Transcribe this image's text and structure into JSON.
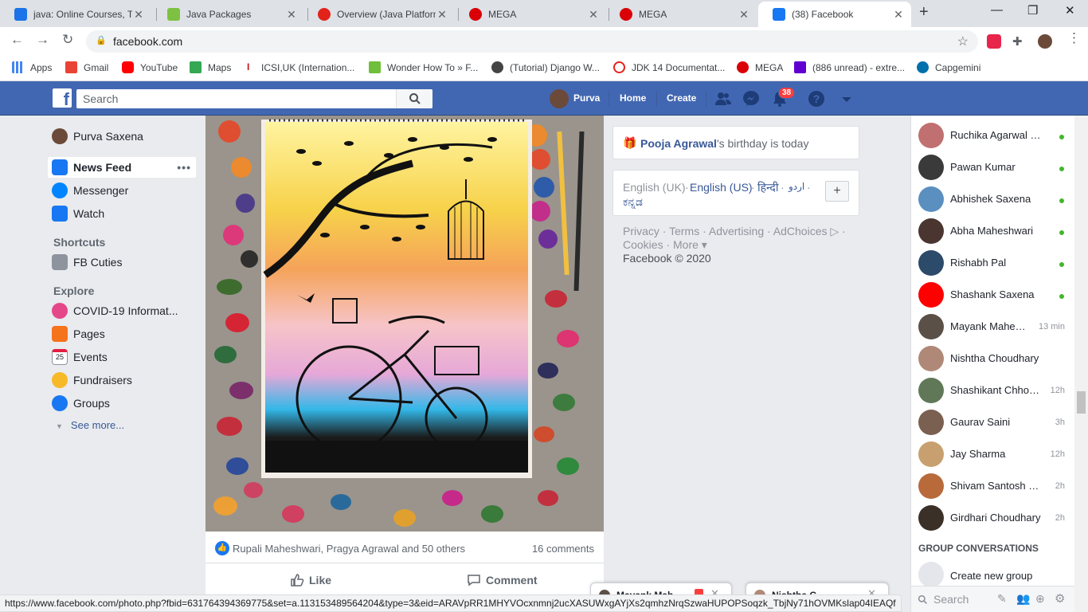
{
  "browser": {
    "tabs": [
      {
        "title": "java: Online Courses, Tr",
        "color": "#1a73e8"
      },
      {
        "title": "Java Packages",
        "color": "#7dc142"
      },
      {
        "title": "Overview (Java Platform",
        "color": "#e2231a"
      },
      {
        "title": "MEGA",
        "color": "#d90007"
      },
      {
        "title": "MEGA",
        "color": "#d90007"
      },
      {
        "title": "(38) Facebook",
        "color": "#1877f2"
      }
    ],
    "url": "facebook.com",
    "bookmarks": [
      {
        "label": "Apps",
        "color": "#4285f4"
      },
      {
        "label": "Gmail",
        "color": "#ea4335"
      },
      {
        "label": "YouTube",
        "color": "#ff0000"
      },
      {
        "label": "Maps",
        "color": "#34a853"
      },
      {
        "label": "ICSI,UK (Internation...",
        "color": "#c4161c"
      },
      {
        "label": "Wonder How To » F...",
        "color": "#6fbf3a"
      },
      {
        "label": "(Tutorial) Django W...",
        "color": "#444444"
      },
      {
        "label": "JDK 14 Documentat...",
        "color": "#e2231a"
      },
      {
        "label": "MEGA",
        "color": "#d90007"
      },
      {
        "label": "(886 unread) - extre...",
        "color": "#6001d2"
      },
      {
        "label": "Capgemini",
        "color": "#0070ad"
      }
    ],
    "status_url": "https://www.facebook.com/photo.php?fbid=631764394369775&set=a.113153489564204&type=3&eid=ARAVpRR1MHYVOcxnmnj2ucXASUWxgAYjXs2qmhzNrqSzwaHUPOPSoqzk_TbjNy71hOVMKslap04IEAQf"
  },
  "header": {
    "search_placeholder": "Search",
    "profile_name": "Purva",
    "home": "Home",
    "create": "Create",
    "notifications_count": "38",
    "brand_color": "#4267b2"
  },
  "sidebar": {
    "user": "Purva Saxena",
    "main_items": [
      {
        "label": "News Feed",
        "icon": "news-feed-icon"
      },
      {
        "label": "Messenger",
        "icon": "messenger-icon"
      },
      {
        "label": "Watch",
        "icon": "watch-icon"
      }
    ],
    "shortcuts_title": "Shortcuts",
    "shortcuts": [
      {
        "label": "FB Cuties",
        "icon": "group-icon"
      }
    ],
    "explore_title": "Explore",
    "explore": [
      {
        "label": "COVID-19 Informat...",
        "icon": "covid-heart-icon"
      },
      {
        "label": "Pages",
        "icon": "flag-icon"
      },
      {
        "label": "Events",
        "icon": "calendar-icon"
      },
      {
        "label": "Fundraisers",
        "icon": "fundraiser-icon"
      },
      {
        "label": "Groups",
        "icon": "groups-icon"
      }
    ],
    "see_more": "See more..."
  },
  "post": {
    "reaction_names": "Rupali Maheshwari, Pragya Agrawal and 50 others",
    "comments": "16 comments",
    "like": "Like",
    "comment": "Comment",
    "calendar_day": "25"
  },
  "right": {
    "birthday_name": "Pooja Agrawal",
    "birthday_text": "'s birthday is today",
    "languages": {
      "english_uk": "English (UK)",
      "english_us": "English (US)",
      "hindi": "हिन्दी",
      "urdu": "اردو",
      "kannada": "ಕನ್ನಡ"
    },
    "footer_line1": "Privacy · Terms · Advertising · AdChoices ▷ ·",
    "footer_line2": "Cookies · More ▾",
    "copyright": "Facebook © 2020"
  },
  "chat": {
    "contacts": [
      {
        "name": "Ruchika Agarwal Garg",
        "status": "",
        "color": "#c07070"
      },
      {
        "name": "Pawan Kumar",
        "status": "",
        "color": "#3a3a3a"
      },
      {
        "name": "Abhishek Saxena",
        "status": "",
        "color": "#5a8fc0"
      },
      {
        "name": "Abha Maheshwari",
        "status": "",
        "color": "#4a3530"
      },
      {
        "name": "Rishabh Pal",
        "status": "",
        "color": "#2c4a6a"
      },
      {
        "name": "Shashank Saxena",
        "status": "",
        "color": "#ff0000"
      },
      {
        "name": "Mayank Mahesh...",
        "status": "13 min",
        "color": "#5a5048"
      },
      {
        "name": "Nishtha Choudhary",
        "status": "",
        "color": "#b08878"
      },
      {
        "name": "Shashikant Chhonkar",
        "status": "12h",
        "color": "#607858"
      },
      {
        "name": "Gaurav Saini",
        "status": "3h",
        "color": "#7a6050"
      },
      {
        "name": "Jay Sharma",
        "status": "12h",
        "color": "#c8a070"
      },
      {
        "name": "Shivam Santosh Sax...",
        "status": "2h",
        "color": "#b86a3a"
      },
      {
        "name": "Girdhari Choudhary",
        "status": "2h",
        "color": "#3a3028"
      }
    ],
    "group_conversations": "GROUP CONVERSATIONS",
    "create_group": "Create new group",
    "search_placeholder": "Search",
    "online_color": "#42b72a"
  },
  "chat_tabs": [
    {
      "name": "Mayank Mah...",
      "color": "#5a5048"
    },
    {
      "name": "Nishtha C...",
      "color": "#b08878"
    }
  ]
}
